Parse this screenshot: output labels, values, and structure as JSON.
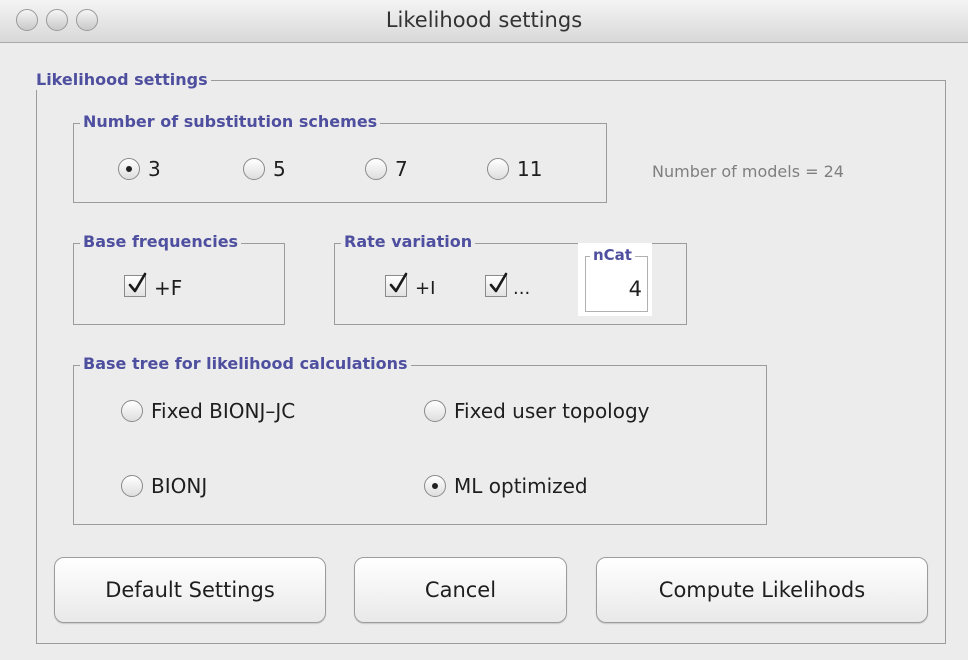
{
  "window": {
    "title": "Likelihood settings"
  },
  "outer_group": {
    "legend": "Likelihood settings"
  },
  "substitution": {
    "legend": "Number of substitution schemes",
    "options": [
      "3",
      "5",
      "7",
      "11"
    ],
    "selected": "3",
    "models_text": "Number of models = 24"
  },
  "base_freq": {
    "legend": "Base frequencies",
    "f_label": "+F",
    "f_checked": true
  },
  "rate_variation": {
    "legend": "Rate variation",
    "i_label": "+I",
    "i_checked": true,
    "g_label": "...",
    "g_checked": true,
    "ncat_label": "nCat",
    "ncat_value": "4"
  },
  "base_tree": {
    "legend": "Base tree for likelihood calculations",
    "options": [
      "Fixed BIONJ–JC",
      "Fixed user topology",
      "BIONJ",
      "ML optimized"
    ],
    "selected": "ML optimized"
  },
  "buttons": {
    "default": "Default Settings",
    "cancel": "Cancel",
    "compute": "Compute Likelihods"
  }
}
